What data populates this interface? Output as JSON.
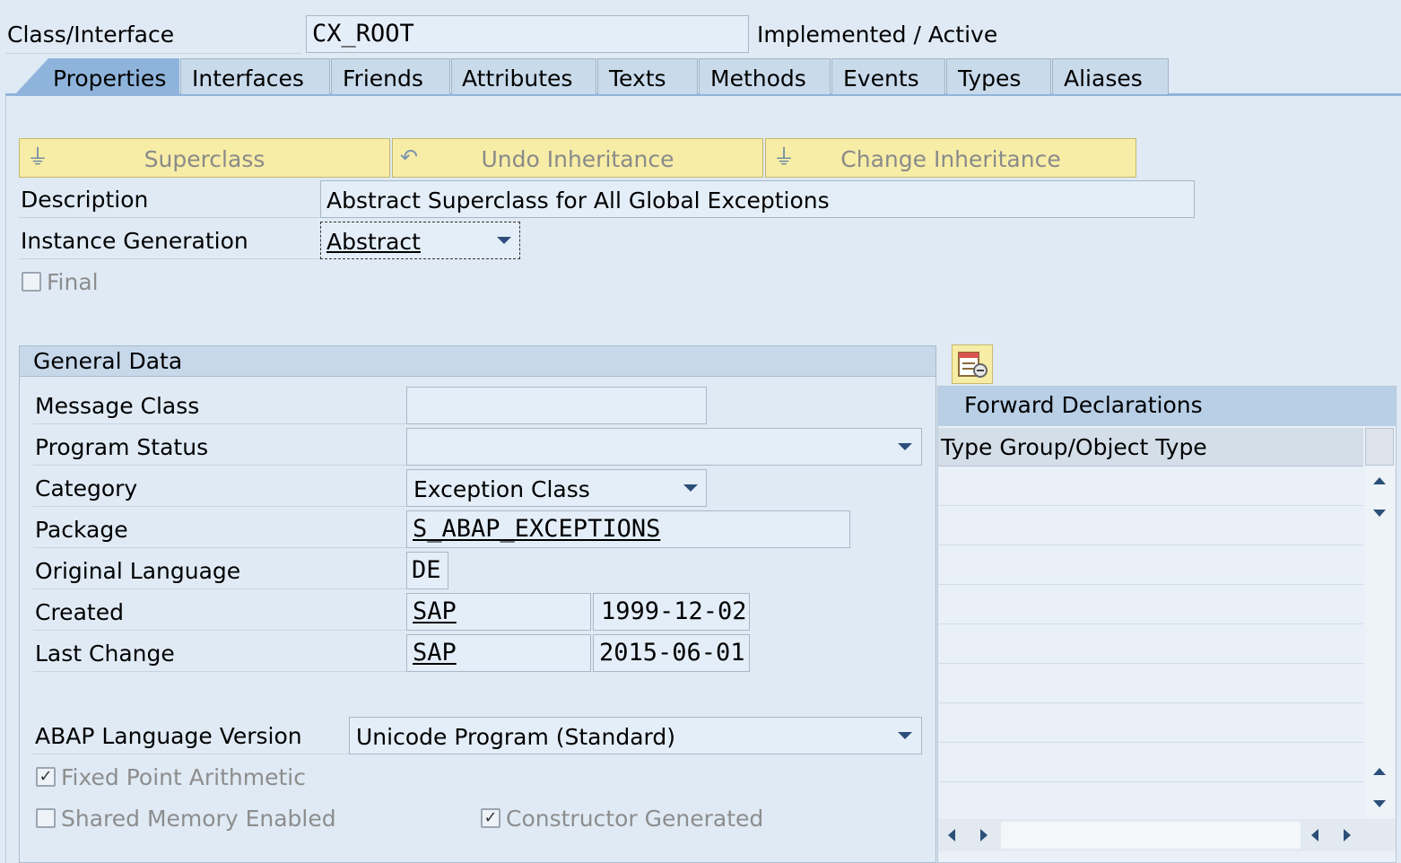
{
  "header": {
    "class_label": "Class/Interface",
    "class_value": "CX_ROOT",
    "status": "Implemented / Active"
  },
  "tabs": [
    {
      "label": "Properties",
      "active": true
    },
    {
      "label": "Interfaces"
    },
    {
      "label": "Friends"
    },
    {
      "label": "Attributes"
    },
    {
      "label": "Texts"
    },
    {
      "label": "Methods"
    },
    {
      "label": "Events"
    },
    {
      "label": "Types"
    },
    {
      "label": "Aliases"
    }
  ],
  "toolbar": {
    "superclass": "Superclass",
    "undo_inheritance": "Undo Inheritance",
    "change_inheritance": "Change Inheritance"
  },
  "properties": {
    "description_label": "Description",
    "description_value": "Abstract Superclass for All Global Exceptions",
    "instance_generation_label": "Instance Generation",
    "instance_generation_value": "Abstract",
    "final_label": "Final"
  },
  "general_data": {
    "title": "General Data",
    "message_class_label": "Message Class",
    "message_class_value": "",
    "program_status_label": "Program Status",
    "program_status_value": "",
    "category_label": "Category",
    "category_value": "Exception Class",
    "package_label": "Package",
    "package_value": "S_ABAP_EXCEPTIONS",
    "original_language_label": "Original Language",
    "original_language_value": "DE",
    "created_label": "Created",
    "created_user": "SAP",
    "created_date": "1999-12-02",
    "last_change_label": "Last Change",
    "last_change_user": "SAP",
    "last_change_date": "2015-06-01",
    "abap_version_label": "ABAP Language Version",
    "abap_version_value": "Unicode Program (Standard)",
    "fixed_point_label": "Fixed Point Arithmetic",
    "fixed_point_checked": true,
    "shared_memory_label": "Shared Memory Enabled",
    "shared_memory_checked": false,
    "constructor_label": "Constructor Generated",
    "constructor_checked": true
  },
  "forward_declarations": {
    "title": "Forward Declarations",
    "column_header": "Type Group/Object Type"
  },
  "colors": {
    "background": "#dfeaf5",
    "button_yellow": "#f7eda6",
    "tab_active": "#8fb4db",
    "field": "#e4eef8"
  }
}
